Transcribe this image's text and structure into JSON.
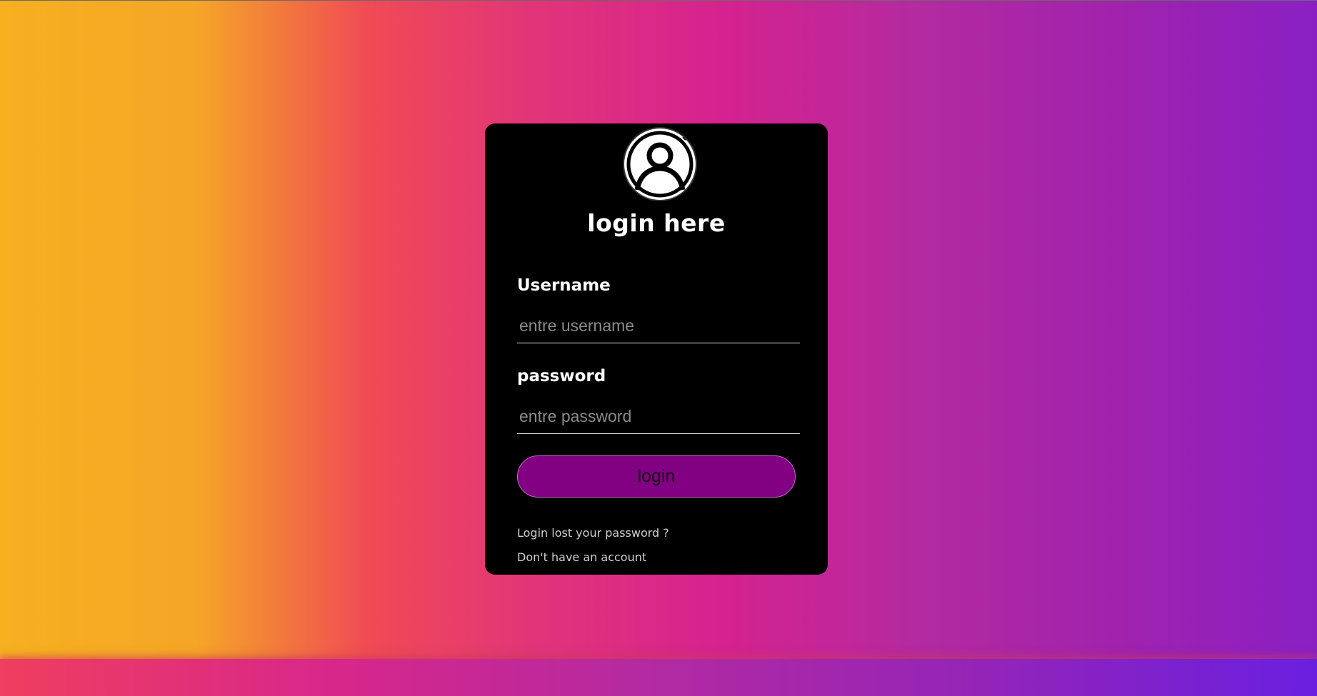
{
  "form": {
    "title": "login here",
    "username_label": "Username",
    "username_placeholder": "entre username",
    "password_label": "password",
    "password_placeholder": "entre password",
    "login_button": "login",
    "lost_password_link": "Login lost your password ?",
    "no_account_link": "Don't have an account"
  },
  "icons": {
    "avatar": "user-avatar-icon"
  },
  "colors": {
    "card_background": "#000000",
    "button_background": "#820082",
    "text": "#ffffff",
    "link_text": "#cfcfcf",
    "placeholder_text": "#8a8a8a"
  }
}
